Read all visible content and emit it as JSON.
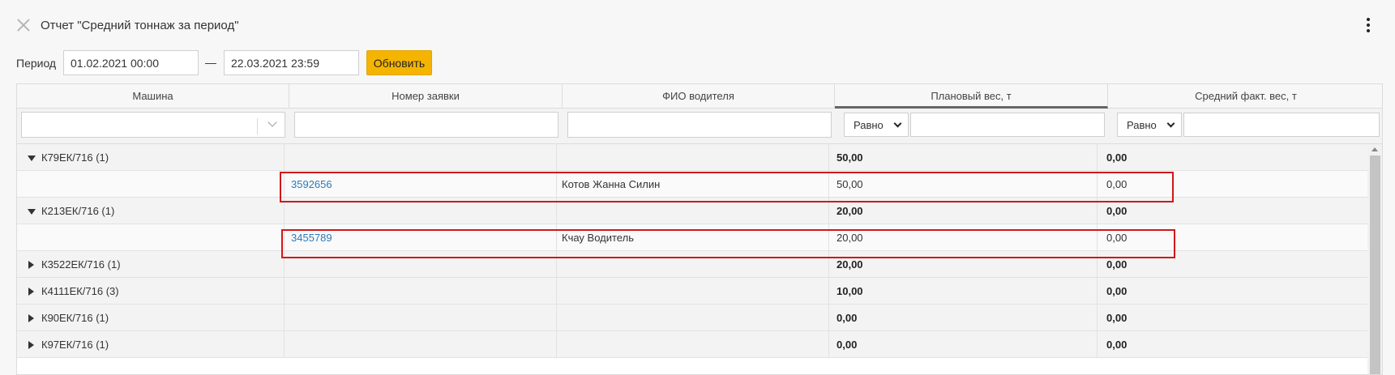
{
  "window": {
    "title": "Отчет \"Средний тоннаж за период\"",
    "close_icon": "close-icon",
    "menu_icon": "more-vertical-icon"
  },
  "filter_bar": {
    "period_label": "Период",
    "date_from": "01.02.2021 00:00",
    "separator": "—",
    "date_to": "22.03.2021 23:59",
    "refresh_label": "Обновить",
    "refresh_color": "#f5b400"
  },
  "grid": {
    "columns": [
      {
        "label": "Машина"
      },
      {
        "label": "Номер заявки"
      },
      {
        "label": "ФИО водителя"
      },
      {
        "label": "Плановый вес, т"
      },
      {
        "label": "Средний факт. вес, т"
      }
    ],
    "sorted_column": "Плановый вес, т",
    "filters": {
      "machine_value": "",
      "order_value": "",
      "driver_value": "",
      "plan_op": "Равно",
      "plan_value": "",
      "fact_op": "Равно",
      "fact_value": ""
    },
    "rows": [
      {
        "type": "group",
        "expanded": true,
        "machine": "К79ЕК/716 (1)",
        "plan": "50,00",
        "fact": "0,00"
      },
      {
        "type": "detail",
        "order": "3592656",
        "driver": "Котов Жанна Силин",
        "plan": "50,00",
        "fact": "0,00"
      },
      {
        "type": "group",
        "expanded": true,
        "machine": "К213ЕК/716 (1)",
        "plan": "20,00",
        "fact": "0,00"
      },
      {
        "type": "detail",
        "order": "3455789",
        "driver": "Кчау Водитель",
        "plan": "20,00",
        "fact": "0,00"
      },
      {
        "type": "group",
        "expanded": false,
        "machine": "К3522ЕК/716 (1)",
        "plan": "20,00",
        "fact": "0,00"
      },
      {
        "type": "group",
        "expanded": false,
        "machine": "К4111ЕК/716 (3)",
        "plan": "10,00",
        "fact": "0,00"
      },
      {
        "type": "group",
        "expanded": false,
        "machine": "К90ЕК/716 (1)",
        "plan": "0,00",
        "fact": "0,00"
      },
      {
        "type": "group",
        "expanded": false,
        "machine": "К97ЕК/716 (1)",
        "plan": "0,00",
        "fact": "0,00"
      }
    ]
  },
  "highlight_color": "#d0181a"
}
